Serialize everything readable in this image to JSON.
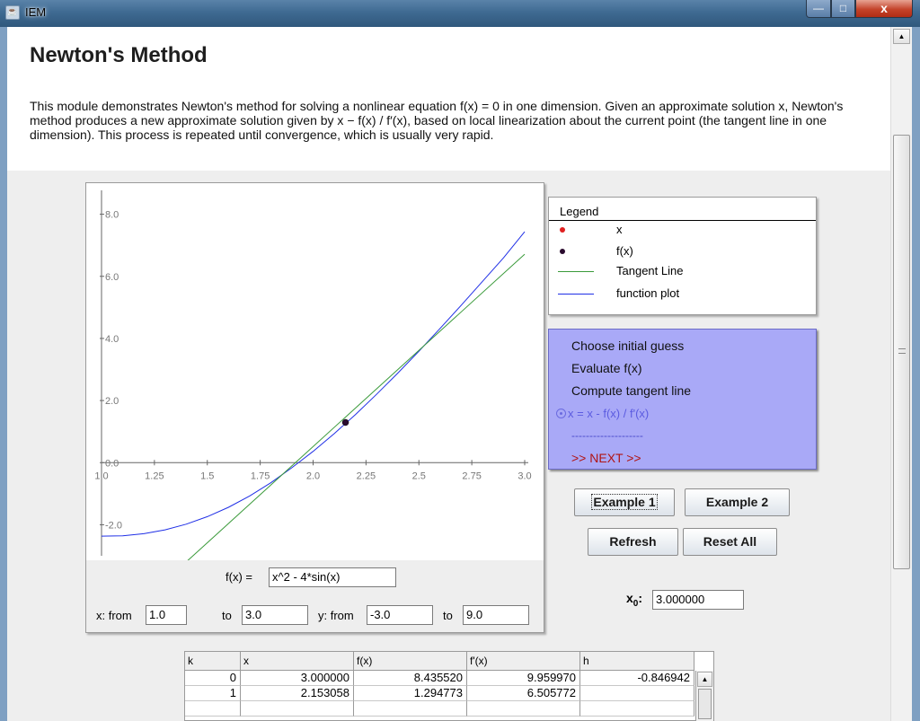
{
  "window": {
    "title": "IEM",
    "minimize": "—",
    "maximize": "□",
    "close": "x"
  },
  "header": {
    "title": "Newton's Method",
    "description": "This module demonstrates Newton's method for solving a nonlinear equation f(x) = 0 in one dimension. Given an approximate solution x, Newton's method produces a new approximate solution given by x − f(x) / f′(x), based on local linearization about the current point (the tangent line in one dimension). This process is repeated until convergence, which is usually very rapid."
  },
  "chart_data": {
    "type": "line",
    "xlim": [
      1.0,
      3.0
    ],
    "ylim": [
      -3.0,
      9.0
    ],
    "x_ticks": [
      "1.0",
      "1.25",
      "1.5",
      "1.75",
      "2.0",
      "2.25",
      "2.5",
      "2.75",
      "3.0"
    ],
    "y_ticks": [
      "8.0",
      "6.0",
      "4.0",
      "2.0",
      "0.0",
      "-2.0"
    ],
    "y_tick_values": [
      8,
      6,
      4,
      2,
      0,
      -2
    ],
    "x_tick_values": [
      1.0,
      1.25,
      1.5,
      1.75,
      2.0,
      2.25,
      2.5,
      2.75,
      3.0
    ],
    "series": [
      {
        "name": "function plot",
        "color": "#1f2fe6",
        "x": [
          1.0,
          1.1,
          1.2,
          1.3,
          1.4,
          1.5,
          1.6,
          1.7,
          1.8,
          1.9,
          2.0,
          2.1,
          2.2,
          2.3,
          2.4,
          2.5,
          2.6,
          2.7,
          2.8,
          2.9,
          3.0
        ],
        "y": [
          -2.366,
          -2.355,
          -2.288,
          -2.164,
          -1.982,
          -1.74,
          -1.438,
          -1.074,
          -0.648,
          -0.164,
          0.363,
          0.935,
          1.549,
          2.199,
          2.881,
          3.59,
          4.321,
          5.07,
          5.831,
          6.594,
          7.436
        ]
      },
      {
        "name": "Tangent Line",
        "color": "#3a9a3a",
        "x": [
          1.4,
          3.0
        ],
        "y": [
          -3.2,
          6.713
        ]
      }
    ],
    "points": [
      {
        "name": "f(x)",
        "x": 2.153058,
        "y": 1.294773,
        "color": "#2a0b2e"
      }
    ]
  },
  "plot_controls": {
    "fx_label": "f(x) =",
    "fx_value": "x^2 - 4*sin(x)",
    "x_from_label": "x: from",
    "x_from": "1.0",
    "to1_label": "to",
    "x_to": "3.0",
    "y_from_label": "y: from",
    "y_from": "-3.0",
    "to2_label": "to",
    "y_to": "9.0"
  },
  "legend": {
    "title": "Legend",
    "items": [
      {
        "label": "x",
        "kind": "dot",
        "color": "#e02020"
      },
      {
        "label": "f(x)",
        "kind": "dot",
        "color": "#2a0b2e"
      },
      {
        "label": "Tangent Line",
        "kind": "line",
        "color": "#3a9a3a"
      },
      {
        "label": "function plot",
        "kind": "line",
        "color": "#1f2fe6"
      }
    ]
  },
  "steps": {
    "items": [
      "Choose initial guess",
      "Evaluate f(x)",
      "Compute tangent line",
      "x = x - f(x) / f'(x)"
    ],
    "separator": "--------------------",
    "next": ">> NEXT >>"
  },
  "buttons": {
    "example1": "Example 1",
    "example2": "Example 2",
    "refresh": "Refresh",
    "reset_all": "Reset All"
  },
  "x0": {
    "label": "x",
    "sub": "0",
    "colon": ":",
    "value": "3.000000"
  },
  "table": {
    "columns": [
      "k",
      "x",
      "f(x)",
      "f'(x)",
      "h"
    ],
    "rows": [
      [
        "0",
        "3.000000",
        "8.435520",
        "9.959970",
        "-0.846942"
      ],
      [
        "1",
        "2.153058",
        "1.294773",
        "6.505772",
        ""
      ]
    ]
  },
  "colors": {
    "steps_bg": "#a9a9f7",
    "next_red": "#b01414",
    "active_step": "#5b5be0"
  }
}
